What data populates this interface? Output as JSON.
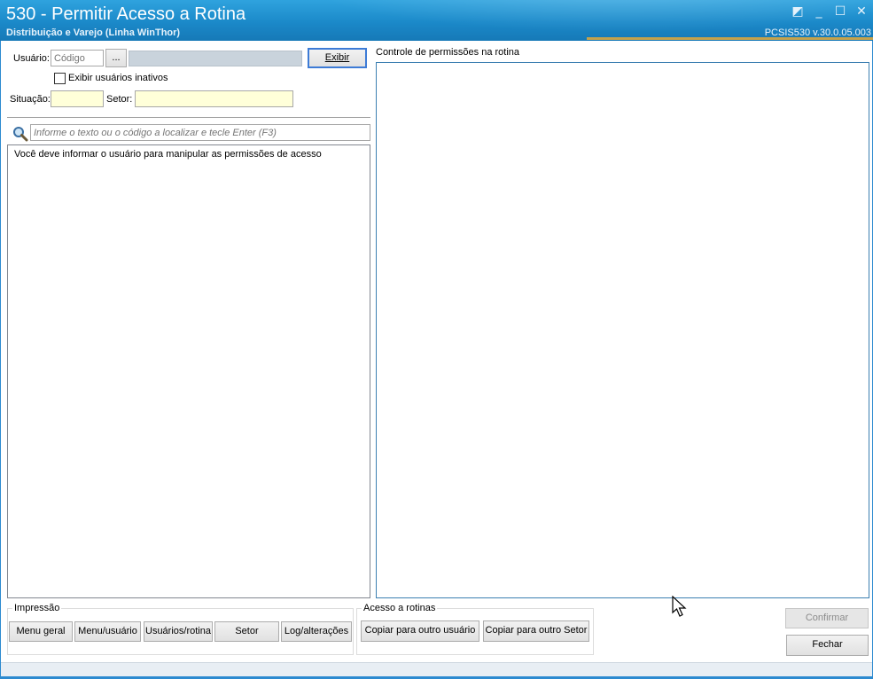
{
  "window": {
    "title": "530 - Permitir Acesso a Rotina",
    "subtitle": "Distribuição e Varejo (Linha WinThor)",
    "version": "PCSIS530  v.30.0.05.003",
    "controls": {
      "restore": "◩",
      "minimize": "_",
      "maximize": "☐",
      "close": "✕"
    }
  },
  "form": {
    "usuario_label": "Usuário:",
    "codigo_placeholder": "Código",
    "ellipsis_label": "...",
    "exibir_label": "Exibir",
    "inativos_label": "Exibir usuários inativos",
    "situacao_label": "Situação:",
    "setor_label": "Setor:"
  },
  "search": {
    "placeholder": "Informe o texto ou o código a localizar e tecle Enter (F3)"
  },
  "left_panel": {
    "message": "Você deve informar o usuário para manipular as permissões de acesso"
  },
  "right_panel": {
    "title": "Controle de permissões na rotina"
  },
  "impressao": {
    "title": "Impressão",
    "buttons": [
      "Menu geral",
      "Menu/usuário",
      "Usuários/rotina",
      "Setor",
      "Log/alterações"
    ]
  },
  "acesso": {
    "title": "Acesso a rotinas",
    "buttons": [
      "Copiar para outro usuário",
      "Copiar para outro Setor"
    ]
  },
  "actions": {
    "confirmar": "Confirmar",
    "fechar": "Fechar"
  },
  "colors": {
    "title_bar": "#1b89c9",
    "accent_line": "#c4a24d",
    "input_yellow": "#ffffd9",
    "focus_border": "#3d7bd6"
  }
}
